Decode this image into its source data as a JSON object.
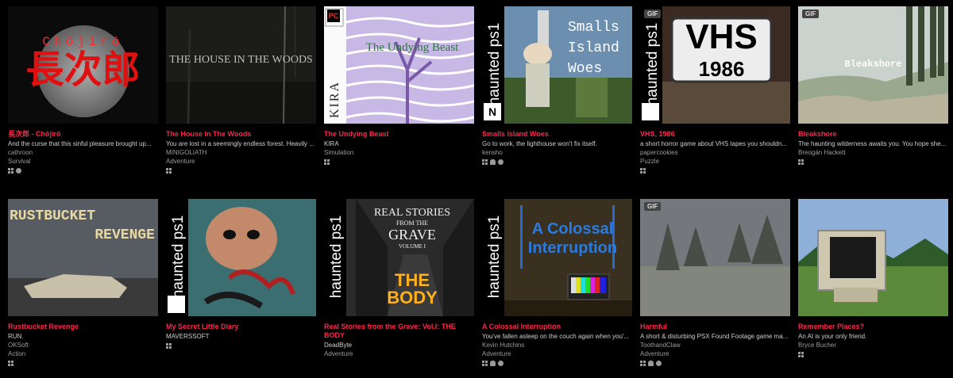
{
  "games": [
    {
      "title": "長次郎 - Chōjirō",
      "description": "And the curse that this sinful pleasure brought up...",
      "author": "cathroon",
      "genre": "Survival",
      "platforms": [
        "windows",
        "mac"
      ],
      "cover_text": [
        "Chōjirō",
        "長次郎"
      ]
    },
    {
      "title": "The House In The Woods",
      "description": "You are lost in a seemingly endless forest. Heavily ...",
      "author": "MINIGOLIATH",
      "genre": "Adventure",
      "platforms": [
        "windows"
      ],
      "cover_text": [
        "THE HOUSE IN THE WOODS"
      ]
    },
    {
      "title": "The Undying Beast",
      "description": "KIRA",
      "author": "Simulation",
      "genre": "",
      "platforms": [
        "windows"
      ],
      "cover_text": [
        "PC",
        "The Undying Beast",
        "KIRA"
      ]
    },
    {
      "title": "Smalls Island Woes",
      "description": "Go to work, the lighthouse won't fix itself.",
      "author": "kensho",
      "genre": "",
      "platforms": [
        "windows",
        "linux",
        "mac"
      ],
      "cover_text": [
        "haunted ps1",
        "Smalls",
        "Island",
        "Woes",
        "N"
      ]
    },
    {
      "title": "VHS, 1986",
      "description": "a short horror game about VHS tapes you shouldn...",
      "author": "papercookies",
      "genre": "Puzzle",
      "platforms": [
        "windows"
      ],
      "cover_text": [
        "GIF",
        "haunted ps1",
        "VHS",
        "1986"
      ]
    },
    {
      "title": "Bleakshore",
      "description": "The haunting wilderness awaits you. You hope she...",
      "author": "Breogán Hackett",
      "genre": "",
      "platforms": [
        "windows"
      ],
      "cover_text": [
        "GIF",
        "Bleakshore"
      ]
    },
    {
      "title": "Rustbucket Revenge",
      "description": "RUN.",
      "author": "OKSoft",
      "genre": "Action",
      "platforms": [
        "windows"
      ],
      "cover_text": [
        "RUSTBUCKET",
        "REVENGE"
      ]
    },
    {
      "title": "My Secret Little Diary",
      "description": "MAVERSSOFT",
      "author": "",
      "genre": "",
      "platforms": [
        "windows"
      ],
      "cover_text": [
        "haunted ps1"
      ]
    },
    {
      "title": "Real Stories from the Grave: Vol.I: THE BODY",
      "description": "DeadByte",
      "author": "Adventure",
      "genre": "",
      "platforms": [],
      "cover_text": [
        "haunted ps1",
        "REAL STORIES",
        "FROM THE",
        "GRAVE",
        "VOLUME I",
        "THE",
        "BODY"
      ]
    },
    {
      "title": "A Colossal Interruption",
      "description": "You've fallen asleep on the couch again when you'...",
      "author": "Kevin Hutchins",
      "genre": "Adventure",
      "platforms": [
        "windows",
        "linux",
        "mac"
      ],
      "cover_text": [
        "haunted ps1",
        "A Colossal",
        "Interruption"
      ]
    },
    {
      "title": "Harmful",
      "description": "A short & disturbing PSX Found Footage game ma...",
      "author": "ToothandClaw",
      "genre": "Adventure",
      "platforms": [
        "windows",
        "linux",
        "mac"
      ],
      "cover_text": [
        "GIF"
      ]
    },
    {
      "title": "Remember Places?",
      "description": "An AI is your only friend.",
      "author": "Bryce Bucher",
      "genre": "",
      "platforms": [
        "windows"
      ],
      "cover_text": []
    }
  ],
  "colors": {
    "title": "#ff2449",
    "background": "#000000",
    "text": "#cfcfcf",
    "muted": "#9a9a9a"
  }
}
